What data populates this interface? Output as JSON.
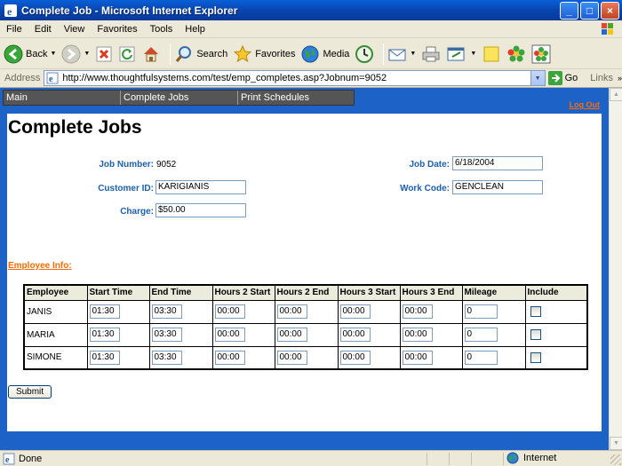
{
  "window": {
    "title": "Complete Job - Microsoft Internet Explorer",
    "buttons": [
      "_",
      "□",
      "×"
    ]
  },
  "menu": [
    "File",
    "Edit",
    "View",
    "Favorites",
    "Tools",
    "Help"
  ],
  "toolbar": {
    "back_label": "Back",
    "search_label": "Search",
    "favorites_label": "Favorites",
    "media_label": "Media"
  },
  "address": {
    "label": "Address",
    "url": "http://www.thoughtfulsystems.com/test/emp_completes.asp?Jobnum=9052",
    "go_label": "Go",
    "links_label": "Links"
  },
  "site_nav": [
    "Main",
    "Complete Jobs",
    "Print Schedules"
  ],
  "logout_label": "Log Out",
  "page": {
    "title": "Complete Jobs",
    "job_number_label": "Job Number:",
    "job_number": "9052",
    "customer_id_label": "Customer ID:",
    "customer_id": "KARIGIANIS",
    "charge_label": "Charge:",
    "charge": "$50.00",
    "job_date_label": "Job Date:",
    "job_date": "6/18/2004",
    "work_code_label": "Work Code:",
    "work_code": "GENCLEAN",
    "employee_info_label": "Employee Info:",
    "submit_label": "Submit"
  },
  "table": {
    "headers": [
      "Employee",
      "Start Time",
      "End Time",
      "Hours 2 Start",
      "Hours 2 End",
      "Hours 3 Start",
      "Hours 3 End",
      "Mileage",
      "Include"
    ],
    "rows": [
      {
        "employee": "JANIS",
        "start": "01:30",
        "end": "03:30",
        "h2s": "00:00",
        "h2e": "00:00",
        "h3s": "00:00",
        "h3e": "00:00",
        "mileage": "0",
        "include": false
      },
      {
        "employee": "MARIA",
        "start": "01:30",
        "end": "03:30",
        "h2s": "00:00",
        "h2e": "00:00",
        "h3s": "00:00",
        "h3e": "00:00",
        "mileage": "0",
        "include": false
      },
      {
        "employee": "SIMONE",
        "start": "01:30",
        "end": "03:30",
        "h2s": "00:00",
        "h2e": "00:00",
        "h3s": "00:00",
        "h3e": "00:00",
        "mileage": "0",
        "include": false
      }
    ]
  },
  "status": {
    "text": "Done",
    "zone": "Internet"
  },
  "colors": {
    "titlebar": "#0a5fd8",
    "content_bg": "#1d63c7",
    "label_blue": "#1a5fb4",
    "link_orange": "#ff6b00"
  }
}
